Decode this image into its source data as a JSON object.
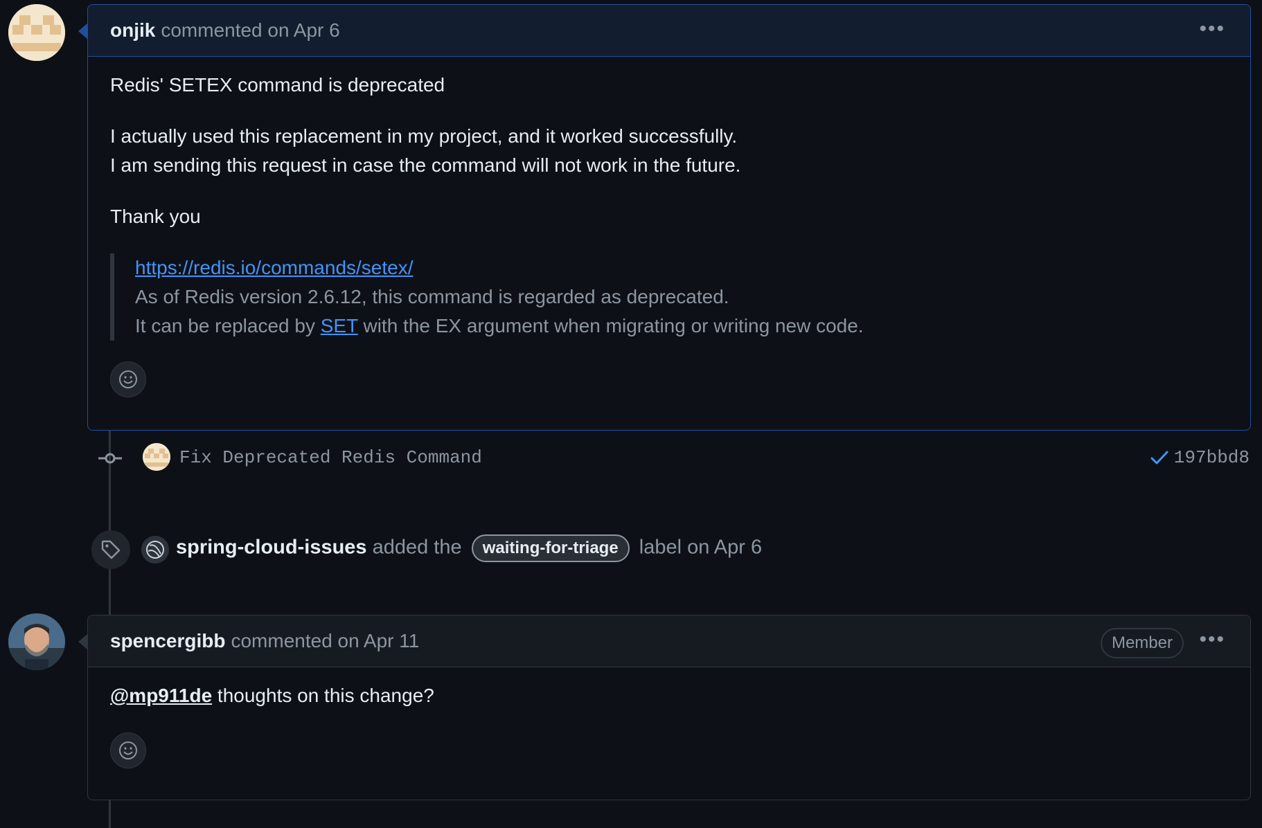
{
  "comment1": {
    "author": "onjik",
    "meta": "commented on Apr 6",
    "more_icon": "kebab-horizontal-icon",
    "title": "Redis' SETEX command is deprecated",
    "line1": "I actually used this replacement in my project, and it worked successfully.",
    "line2": "I am sending this request in case the command will not work in the future.",
    "thanks": "Thank you",
    "quote_link": "https://redis.io/commands/setex/",
    "quote_line1": "As of Redis version 2.6.12, this command is regarded as deprecated.",
    "quote_line2_pre": "It can be replaced by ",
    "quote_line2_link": "SET",
    "quote_line2_post": " with the EX argument when migrating or writing new code.",
    "reaction_icon": "smiley-icon"
  },
  "commit": {
    "icon": "git-commit-icon",
    "message": "Fix Deprecated Redis Command",
    "status_icon": "check-icon",
    "status_color": "#4493f8",
    "sha": "197bbd8"
  },
  "label_event": {
    "icon": "tag-icon",
    "actor": "spring-cloud-issues",
    "text_before": "added the",
    "label": "waiting-for-triage",
    "text_after": "label on Apr 6"
  },
  "comment2": {
    "author": "spencergibb",
    "meta": "commented on Apr 11",
    "badge": "Member",
    "more_icon": "kebab-horizontal-icon",
    "mention": "@mp911de",
    "body": " thoughts on this change?",
    "reaction_icon": "smiley-icon"
  },
  "colors": {
    "background": "#0d1117",
    "link": "#4493f8",
    "highlight_border": "#1f4f9c"
  }
}
